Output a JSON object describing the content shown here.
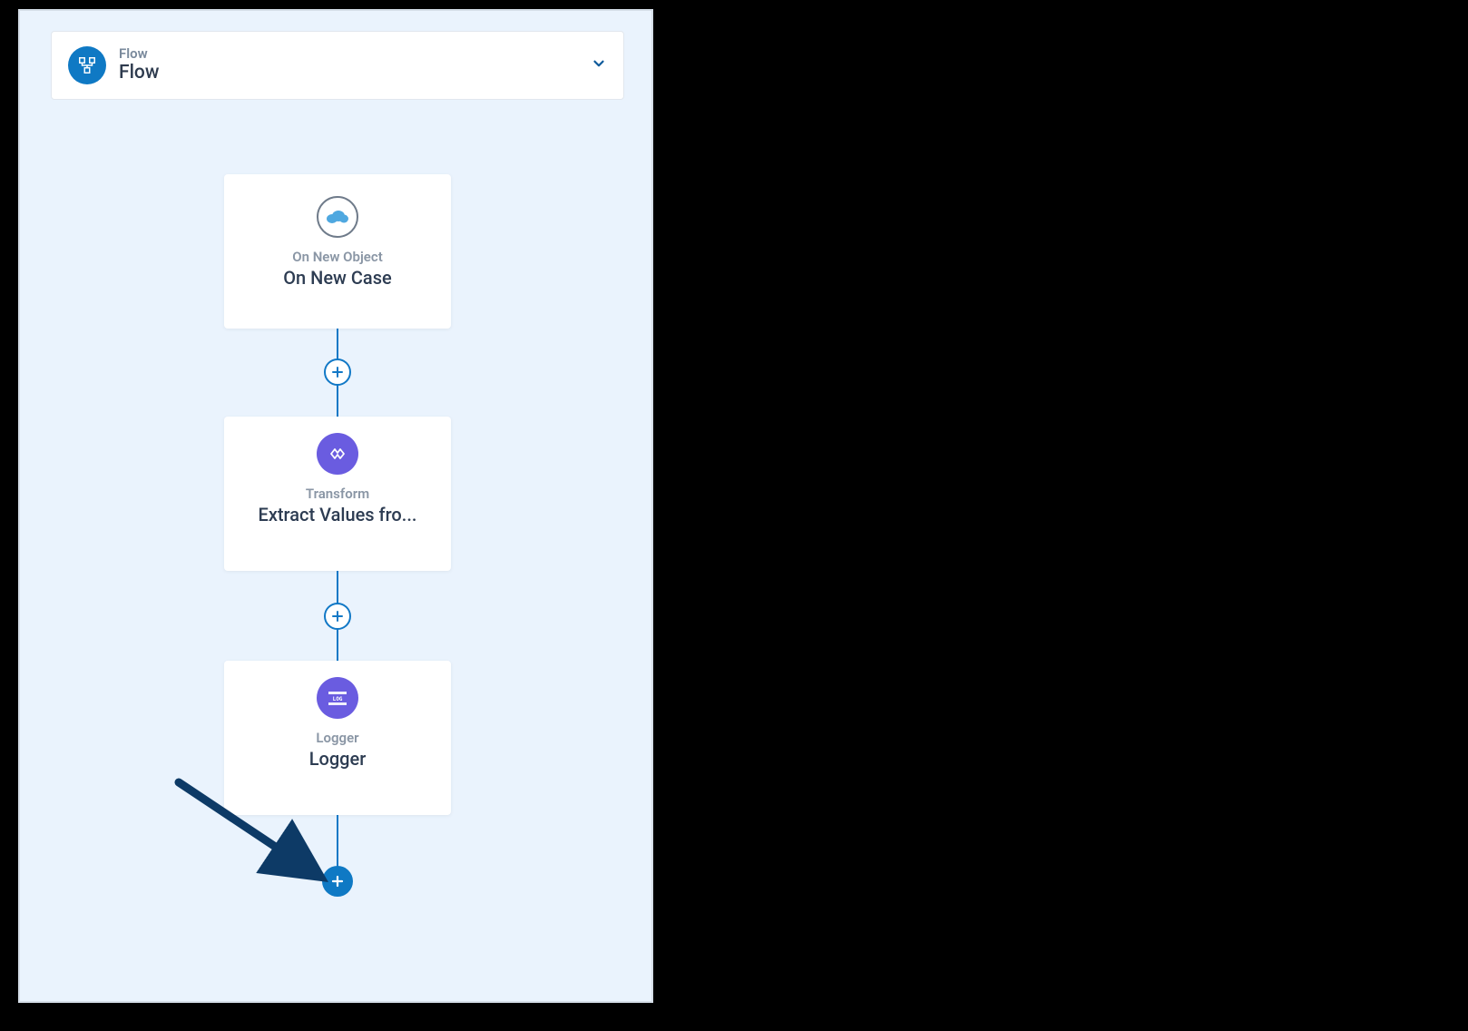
{
  "header": {
    "type_label": "Flow",
    "name": "Flow"
  },
  "nodes": [
    {
      "type_label": "On New Object",
      "name": "On New Case",
      "icon": "salesforce-cloud-icon",
      "icon_style": "outline"
    },
    {
      "type_label": "Transform",
      "name": "Extract Values fro...",
      "icon": "transform-icon",
      "icon_style": "purple"
    },
    {
      "type_label": "Logger",
      "name": "Logger",
      "icon": "log-icon",
      "icon_style": "purple"
    }
  ],
  "colors": {
    "canvas_bg": "#eaf3fd",
    "card_bg": "#ffffff",
    "accent_blue": "#0f79c4",
    "accent_purple": "#6a5ce0",
    "connector": "#1178c6",
    "text_muted": "#8a96a5",
    "text_dark": "#2d3c52",
    "arrow": "#0d3a66"
  }
}
